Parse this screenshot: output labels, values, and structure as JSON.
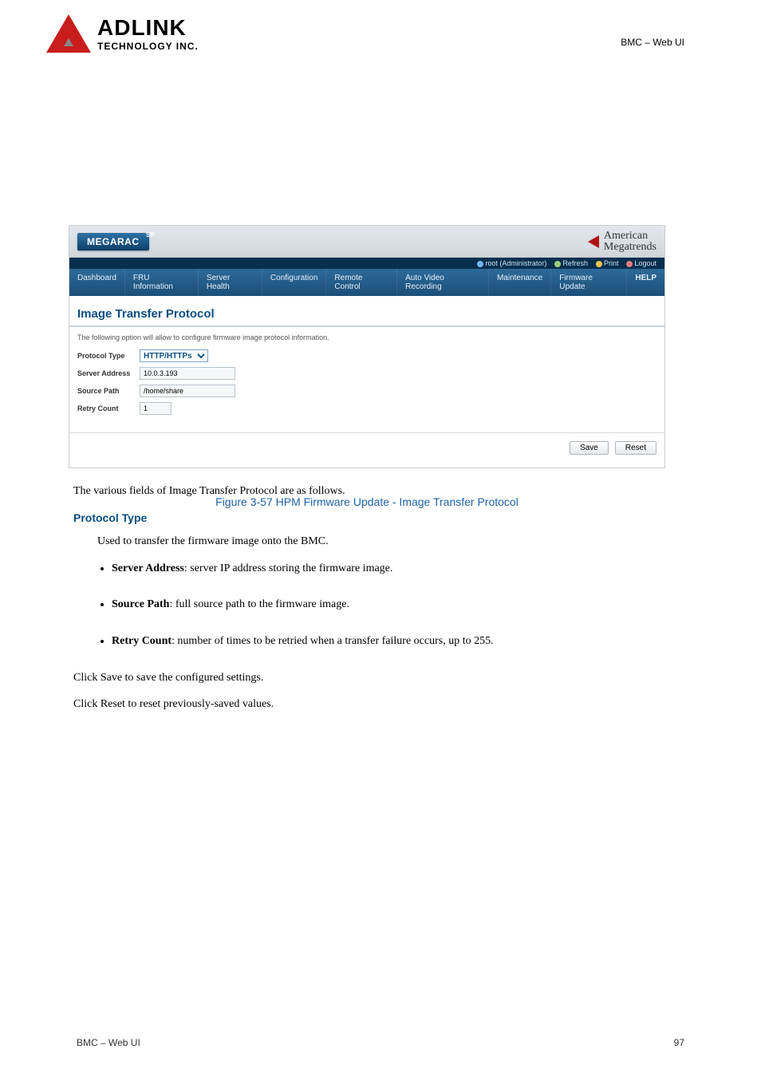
{
  "doc": {
    "header_label": "BMC – Web UI",
    "logo": {
      "big": "ADLINK",
      "small": "TECHNOLOGY INC."
    }
  },
  "ui": {
    "brand": "MEGARAC",
    "brand_sup": "SP",
    "ami": {
      "line1": "American",
      "line2": "Megatrends"
    },
    "userbar": {
      "user": "root (Administrator)",
      "refresh": "Refresh",
      "print": "Print",
      "logout": "Logout"
    },
    "menu": [
      "Dashboard",
      "FRU Information",
      "Server Health",
      "Configuration",
      "Remote Control",
      "Auto Video Recording",
      "Maintenance",
      "Firmware Update"
    ],
    "help": "HELP",
    "page_title": "Image Transfer Protocol",
    "page_desc": "The following option will allow to configure firmware image protocol information.",
    "form": {
      "protocol_label": "Protocol Type",
      "protocol_value": "HTTP/HTTPs",
      "server_label": "Server Address",
      "server_value": "10.0.3.193",
      "source_label": "Source Path",
      "source_value": "/home/share",
      "retry_label": "Retry Count",
      "retry_value": "1"
    },
    "buttons": {
      "save": "Save",
      "reset": "Reset"
    }
  },
  "caption": "Figure 3-57 HPM Firmware Update - Image Transfer Protocol",
  "text": {
    "intro": "The various fields of Image Transfer Protocol are as follows.",
    "sec_head": "Protocol Type",
    "sec_body": "Used to transfer the firmware image onto the BMC.",
    "items": [
      {
        "head": "Server Address",
        "body": ": server IP address storing the firmware image."
      },
      {
        "head": "Source Path",
        "body": ": full source path to the firmware image."
      },
      {
        "head": "Retry Count",
        "body": ": number of times to be retried when a transfer failure occurs, up to 255."
      }
    ],
    "save": "Click Save to save the configured settings.",
    "reset": "Click Reset to reset previously-saved values."
  },
  "footer": {
    "left": "BMC – Web UI",
    "right": "97"
  }
}
